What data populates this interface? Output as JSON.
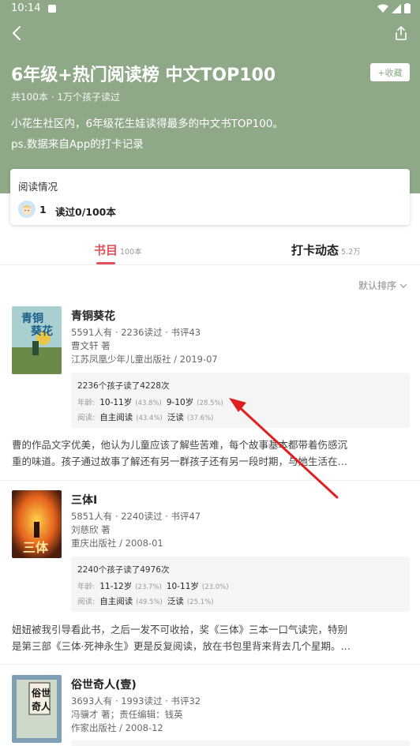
{
  "status": {
    "time": "10:14"
  },
  "header": {
    "title": "6年级+热门阅读榜 中文TOP100",
    "fav_label": "+收藏",
    "subtitle": "共100本 · 1万个孩子读过",
    "desc_line1": "小花生社区内，6年级花生娃读得最多的中文书TOP100。",
    "desc_line2": "ps.数据来自App的打卡记录",
    "bg_color": "#8ea888"
  },
  "reading": {
    "title": "阅读情况",
    "count": "1",
    "progress": "读过0/100本"
  },
  "tabs": [
    {
      "label": "书目",
      "count": "100本"
    },
    {
      "label": "打卡动态",
      "count": "5.2万"
    }
  ],
  "sort_label": "默认排序",
  "books": [
    {
      "title": "青铜葵花",
      "meta": "5591人有 · 2236读过 · 书评43",
      "author": "曹文轩 著",
      "publisher": "江苏凤凰少年儿童出版社 / 2019-07",
      "stat_line": "2236个孩子读了4228次",
      "age_label": "年龄:",
      "age1": "10-11岁",
      "age1_pct": "(43.8%)",
      "age2": "9-10岁",
      "age2_pct": "(28.5%)",
      "read_label": "阅读:",
      "mode1": "自主阅读",
      "mode1_pct": "(43.4%)",
      "mode2": "泛读",
      "mode2_pct": "(37.6%)",
      "review_line1": "曹的作品文字优美，他认为儿童应该了解些苦难，每个故事基本都带着伤感沉",
      "review_line2": "重的味道。孩子通过故事了解还有另一群孩子还有另一段时期，与她生活在…",
      "cover_text": "青铜葵花"
    },
    {
      "title": "三体I",
      "meta": "5851人有 · 2240读过 · 书评47",
      "author": "刘慈欣 著",
      "publisher": "重庆出版社 / 2008-01",
      "stat_line": "2240个孩子读了4976次",
      "age_label": "年龄:",
      "age1": "11-12岁",
      "age1_pct": "(23.7%)",
      "age2": "10-11岁",
      "age2_pct": "(23.0%)",
      "read_label": "阅读:",
      "mode1": "自主阅读",
      "mode1_pct": "(49.5%)",
      "mode2": "泛读",
      "mode2_pct": "(25.1%)",
      "review_line1": "妞妞被我引导看此书，之后一发不可收拾，奖《三体》三本一口气读完，特别",
      "review_line2": "是第三部《三体·死神永生》更是反复阅读，放在书包里背来背去几个星期。…",
      "cover_text": "三体"
    },
    {
      "title": "俗世奇人(壹)",
      "meta": "3693人有 · 1993读过 · 书评32",
      "author": "冯骥才 著；责任编辑：钱英",
      "publisher": "作家出版社 / 2008-12",
      "cover_text": "俗世奇人"
    }
  ],
  "annotation": {
    "arrow_color": "#e02020"
  }
}
